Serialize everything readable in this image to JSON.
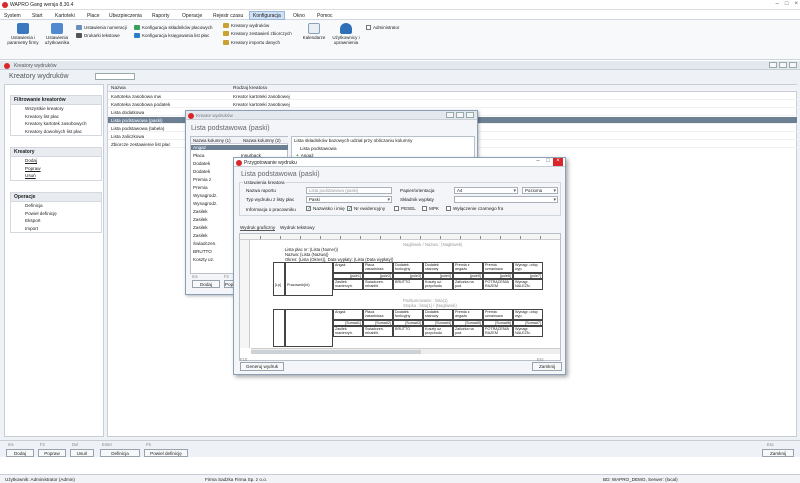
{
  "app": {
    "title": "WAPRO Gang wersja 8.30.4"
  },
  "menu": [
    "System",
    "Start",
    "Kartoteki",
    "Płace",
    "Ubezpieczenia",
    "Raporty",
    "Operacje",
    "Rejestr czasu",
    "Konfiguracja",
    "Okno",
    "Pomoc"
  ],
  "menu_active": "Konfiguracja",
  "ribbon": {
    "big1": "Ustawienia i parametry firmy",
    "big2": "Ustawienia użytkownika",
    "small": [
      "Ustawienia numeracji",
      "Drukarki tekstowe",
      "Konfiguracja składników płacowych",
      "Konfiguracja księgowania list płac",
      "Kreatory wydruków",
      "Kreatory zestawień zbiorczych",
      "Kreatory importu danych"
    ],
    "kalendarz": "Kalendarze",
    "uzytkownicy": "Użytkownicy i uprawnienia",
    "administrator": "Administrator"
  },
  "doc": {
    "window_title": "Kreatory wydruków",
    "heading": "Kreatory wydruków"
  },
  "left": {
    "g1_title": "Filtrowanie kreatorów",
    "g1_items": [
      "Wszystkie kreatory",
      "Kreatory list płac",
      "Kreatory kartotek zasobowych",
      "Kreatory dowolnych list płac"
    ],
    "g2_title": "Kreatory",
    "g2_items": [
      "Dodaj",
      "Popraw",
      "Usuń"
    ],
    "g3_title": "Operacje",
    "g3_items": [
      "Definicja",
      "Powiel definicję",
      "Eksport",
      "Import"
    ]
  },
  "list": {
    "col_name": "Nazwa",
    "col_type": "Rodzaj kreatora",
    "rows": [
      {
        "name": "Kartoteka zasobowa mw",
        "type": "Kreator kartoteki zasobowej"
      },
      {
        "name": "Kartoteka zasobowa podatek",
        "type": "Kreator kartoteki zasobowej"
      },
      {
        "name": "Lista dodatkowa",
        "type": ""
      },
      {
        "name": "Lista podstawowa (paski)",
        "type": ""
      },
      {
        "name": "Lista podstawowa (tabela)",
        "type": ""
      },
      {
        "name": "Lista zaliczkowa",
        "type": ""
      },
      {
        "name": "Zbiorcze zestawienie list płac",
        "type": ""
      }
    ]
  },
  "bottom": {
    "keys": [
      "Ins",
      "F2",
      "Del",
      "Enter",
      "F5",
      "Esc"
    ],
    "buttons": [
      "Dodaj",
      "Popraw",
      "Usuń",
      "Definicja",
      "Powiel definicję",
      "Zamknij"
    ]
  },
  "status": {
    "user": "Użytkownik: Administrator (Admin)",
    "firm": "Firma Sadzka Firma Sp. z o.o.",
    "db": "BD: WAPRO_DEMO, Serwer: (local)"
  },
  "win1": {
    "title": "Kreator wydruków",
    "subtitle": "Lista podstawowa (paski)",
    "col1": "Nazwa kolumny (1)",
    "col2": "Nazwa kolumny (2)",
    "rows": [
      "Angaż",
      "Płaca",
      "Dodatek",
      "Dodatek",
      "Premia z",
      "Premia",
      "Wynagrodz.",
      "Wynagrodz.",
      "Zasiłek",
      "Zasiłek",
      "Zasiłek",
      "Zasiłek",
      "Świadczen.",
      "BRUTTO",
      "Koszty uz."
    ],
    "row2_col2": "Insurback",
    "right_label": "Lista składników bazowych udział przy obliczaniu kolumny",
    "right_item": "Lista podstawowa",
    "right_item2": "Angaż",
    "keys": [
      "Ins",
      "F2"
    ],
    "btn1": "Dodaj",
    "btn2": "Popraw"
  },
  "win2": {
    "title": "Przygotowanie wydruku",
    "subtitle": "Lista podstawowa (paski)",
    "group": "Ustawienia kreatora",
    "lbl_name": "Nazwa raportu",
    "val_name": "Lista podstawowa (paski)",
    "lbl_type": "Typ wydruku z listy płac",
    "val_type": "Paski",
    "lbl_paper": "Papier/orientacja",
    "val_paper": "A4",
    "val_orient": "Pozioma",
    "lbl_component": "Składnik wypłaty",
    "lbl_info": "Informacja o pracowniku",
    "cb": [
      "Nazwisko i imię",
      "Nr ewidencyjny",
      "PESEL",
      "MPK",
      "Wyłączenie czarnego fra"
    ],
    "tab1": "Wydruk graficzny",
    "tab2": "Wydruk tekstowy",
    "d_banner": "Lista płac nr: {Lista (Numer)}",
    "d_name": "Nazwa: {Lista (Nazwa)}",
    "d_period": "Okres: {Lista (Okres)}, Data wypłaty: {Lista (Data wypłaty)}",
    "band1": "Nagłówek / Nazwa : {Nagłówek}",
    "band2": "Podsumowanie : lista{1}",
    "band3": "Stopka : lista{1} / {Nagłówek}",
    "cells_top": [
      "Angaż",
      "Płaca zasadnicza",
      "Dodatek funkcyjny",
      "Dodatek stażowy",
      "Premia z angażu",
      "Premia uznaniowa",
      "Wynagr. urlop wyp."
    ],
    "cells_mid": [
      "[pole1]",
      "[pole2]",
      "[pole3]",
      "[pole4]",
      "[pole5]",
      "[pole6]",
      "[pole7]"
    ],
    "cells_bot": [
      "Zasiłek macierzyń.",
      "Świadczen. rehabilit.",
      "BRUTTO",
      "Koszty uz. przychodu",
      "Zaliczka na pod.",
      "POTRĄCENIA RAZEM",
      "Wynagr. NALEŻN."
    ],
    "cells_top2": [
      "Angaż",
      "Płaca zasadnicza",
      "Dodatek funkcyjny",
      "Dodatek stażowy",
      "Premia z angażu",
      "Premia uznaniowa",
      "Wynagr. urlop wyp."
    ],
    "cells_mid2": [
      "[Suma#1]",
      "[Suma#2]",
      "[Suma#3]",
      "[Suma#4]",
      "[Suma#5]",
      "[Suma#6]",
      "[Suma#7]"
    ],
    "cells_bot2": [
      "Zasiłek macierzyń.",
      "Świadczen. rehabilit.",
      "BRUTTO",
      "Koszty uz. przychodu",
      "Zaliczka na pod.",
      "POTRĄCENIA RAZEM",
      "Wynagr. NALEŻN."
    ],
    "lp": "[Lp]",
    "person": "Pracownik(Id)",
    "keys_left": "F10",
    "keys_right": "Esc",
    "btn_generate": "Generuj wydruk",
    "btn_close": "Zamknij"
  }
}
